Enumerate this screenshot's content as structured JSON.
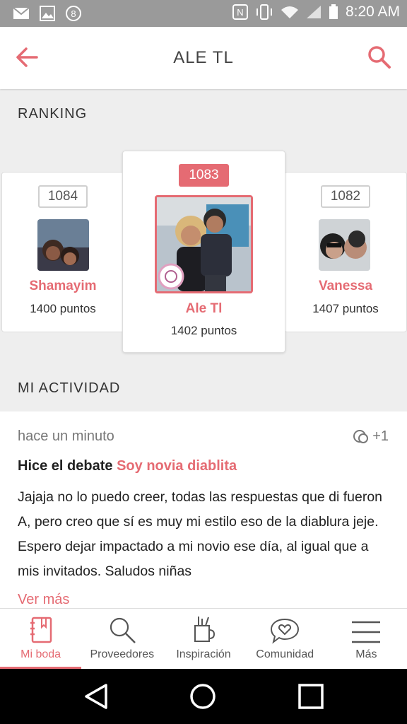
{
  "status_bar": {
    "time": "8:20 AM",
    "left_icons": [
      "mail-icon",
      "image-icon",
      "coin-icon"
    ],
    "right_icons": [
      "nfc-icon",
      "vibrate-icon",
      "wifi-icon",
      "signal-icon",
      "battery-icon"
    ]
  },
  "header": {
    "title": "ALE TL"
  },
  "ranking": {
    "title": "RANKING",
    "left": {
      "rank": "1084",
      "name": "Shamayim",
      "points": "1400 puntos"
    },
    "center": {
      "rank": "1083",
      "name": "Ale Tl",
      "points": "1402 puntos"
    },
    "right": {
      "rank": "1082",
      "name": "Vanessa",
      "points": "1407 puntos"
    }
  },
  "activity": {
    "title": "MI ACTIVIDAD",
    "time": "hace un minuto",
    "comment_count": "+1",
    "prefix": "Hice el debate",
    "debate_link": "Soy novia diablita",
    "body": "Jajaja no lo puedo creer, todas las respuestas que di fueron A, pero creo que sí es muy mi estilo eso de la diablura jeje. Espero dejar impactado a mi novio ese día, al igual que a mis invitados. Saludos niñas",
    "more": "Ver más"
  },
  "tabs": [
    {
      "label": "Mi boda",
      "icon": "notebook-icon",
      "active": true
    },
    {
      "label": "Proveedores",
      "icon": "search-icon"
    },
    {
      "label": "Inspiración",
      "icon": "brush-cup-icon"
    },
    {
      "label": "Comunidad",
      "icon": "chat-heart-icon"
    },
    {
      "label": "Más",
      "icon": "menu-icon"
    }
  ],
  "colors": {
    "accent": "#e56b73",
    "background": "#eeeeee",
    "status_bar": "#9a9a9a"
  }
}
